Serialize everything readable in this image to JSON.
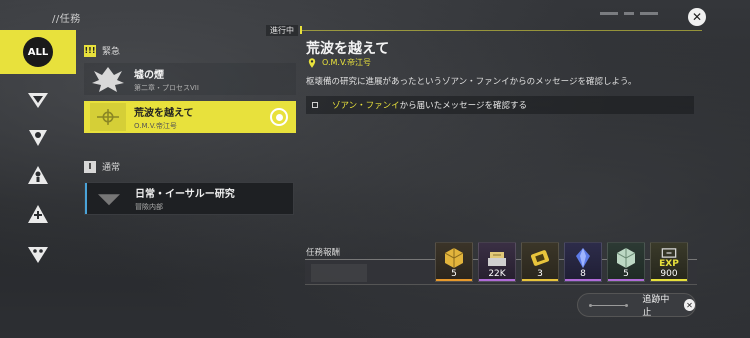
{
  "header": {
    "title": "//任務",
    "close_icon": "close-icon"
  },
  "sidebar": {
    "items": [
      {
        "label": "ALL",
        "icon": "all-badge",
        "active": true
      },
      {
        "icon": "faction-v-icon"
      },
      {
        "icon": "faction-triangle-icon"
      },
      {
        "icon": "faction-figure-icon"
      },
      {
        "icon": "faction-cross-icon"
      },
      {
        "icon": "faction-mask-icon"
      }
    ]
  },
  "sections": {
    "urgent": {
      "icon": "!!!",
      "label": "緊急"
    },
    "normal": {
      "icon": "I",
      "label": "通常"
    }
  },
  "quests": [
    {
      "title": "墟の煙",
      "subtitle": "第二章・プロセスVII",
      "selected": false
    },
    {
      "title": "荒波を越えて",
      "subtitle": "O.M.V.帝江号",
      "selected": true
    },
    {
      "title": "日常・イーサルー研究",
      "subtitle": "冒險内部",
      "selected": false
    }
  ],
  "detail": {
    "status": "進行中",
    "title": "荒波を越えて",
    "location": "O.M.V.帝江号",
    "description": "枢壊備の研究に進展があったというゾアン・ファンイからのメッセージを確認しよう。",
    "objective": {
      "highlight": "ゾアン・ファンイ",
      "rest": "から届いたメッセージを確認する"
    }
  },
  "rewards": {
    "label": "任務報酬",
    "items": [
      {
        "count": "5",
        "icon": "gold-crate-icon",
        "rarity_color": "#e89a2c"
      },
      {
        "count": "22K",
        "icon": "credit-stack-icon",
        "rarity_color": "#b06cd8"
      },
      {
        "count": "3",
        "icon": "gold-device-icon",
        "rarity_color": "#e8c43c"
      },
      {
        "count": "8",
        "icon": "blue-crystal-icon",
        "rarity_color": "#b06cd8"
      },
      {
        "count": "5",
        "icon": "green-crate-icon",
        "rarity_color": "#b06cd8"
      },
      {
        "count": "900",
        "icon": "exp-icon",
        "exp_label": "EXP",
        "rarity_color": "#e8e13c"
      }
    ]
  },
  "stop_button": {
    "label": "追跡中止"
  },
  "colors": {
    "accent": "#e8e13c",
    "panel": "#1e2023",
    "normal_accent": "#4aa3d8"
  }
}
